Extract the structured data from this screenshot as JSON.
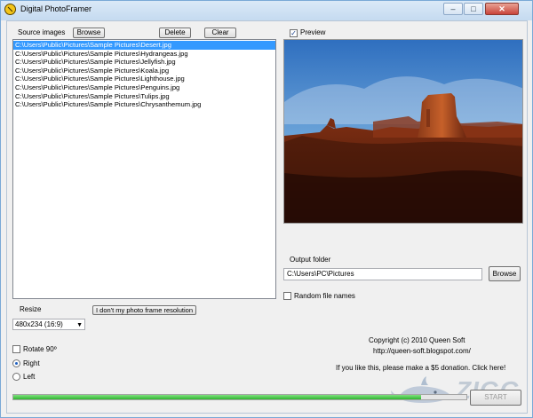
{
  "window": {
    "title": "Digital PhotoFramer",
    "min_label": "–",
    "max_label": "□",
    "close_label": "✕"
  },
  "source": {
    "label": "Source images",
    "browse_label": "Browse",
    "delete_label": "Delete",
    "clear_label": "Clear",
    "files": [
      "C:\\Users\\Public\\Pictures\\Sample Pictures\\Desert.jpg",
      "C:\\Users\\Public\\Pictures\\Sample Pictures\\Hydrangeas.jpg",
      "C:\\Users\\Public\\Pictures\\Sample Pictures\\Jellyfish.jpg",
      "C:\\Users\\Public\\Pictures\\Sample Pictures\\Koala.jpg",
      "C:\\Users\\Public\\Pictures\\Sample Pictures\\Lighthouse.jpg",
      "C:\\Users\\Public\\Pictures\\Sample Pictures\\Penguins.jpg",
      "C:\\Users\\Public\\Pictures\\Sample Pictures\\Tulips.jpg",
      "C:\\Users\\Public\\Pictures\\Sample Pictures\\Chrysanthemum.jpg"
    ],
    "selected_index": 0
  },
  "preview": {
    "label": "Preview",
    "checked": true
  },
  "output": {
    "label": "Output folder",
    "value": "C:\\Users\\PC\\Pictures",
    "browse_label": "Browse"
  },
  "random": {
    "label": "Random file names",
    "checked": false
  },
  "resize": {
    "label": "Resize",
    "value": "480x234 (16:9)",
    "unknown_button": "I don't my photo frame resolution"
  },
  "rotate": {
    "label": "Rotate 90º",
    "checked": false,
    "right_label": "Right",
    "left_label": "Left",
    "selected": "right"
  },
  "about": {
    "copyright": "Copyright (c) 2010 Queen Soft",
    "url": "http://queen-soft.blogspot.com/",
    "donation": "If you like this, please make a $5 donation. Click here!"
  },
  "start_label": "START",
  "progress": 0.9,
  "watermark": "ZIGG",
  "colors": {
    "selection": "#3399ff",
    "progress": "#2fb52f",
    "titlebar": "#c5daf0"
  }
}
